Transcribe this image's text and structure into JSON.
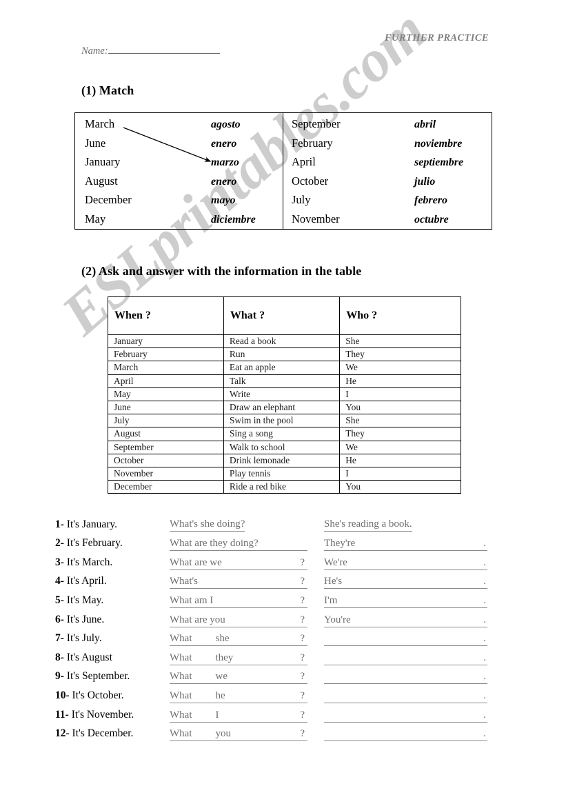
{
  "header": {
    "further_practice": "FURTHER PRACTICE",
    "name_label": "Name:"
  },
  "watermark": {
    "text": "ESLprintables.com",
    "color": "#cdcdcd"
  },
  "section1": {
    "heading": "(1) Match",
    "left_pairs": [
      {
        "english": "March",
        "spanish": "agosto"
      },
      {
        "english": "June",
        "spanish": "enero"
      },
      {
        "english": "January",
        "spanish": "marzo"
      },
      {
        "english": "August",
        "spanish": "enero"
      },
      {
        "english": "December",
        "spanish": "mayo"
      },
      {
        "english": "May",
        "spanish": "diciembre"
      }
    ],
    "right_pairs": [
      {
        "english": "September",
        "spanish": "abril"
      },
      {
        "english": "February",
        "spanish": "noviembre"
      },
      {
        "english": "April",
        "spanish": "septiembre"
      },
      {
        "english": "October",
        "spanish": "julio"
      },
      {
        "english": "July",
        "spanish": "febrero"
      },
      {
        "english": "November",
        "spanish": "octubre"
      }
    ],
    "example_arrow": {
      "from": "March",
      "to": "marzo"
    }
  },
  "section2": {
    "heading": "(2) Ask and answer with the information in the table",
    "columns": [
      "When ?",
      "What ?",
      "Who ?"
    ],
    "rows": [
      [
        "January",
        "Read a book",
        "She"
      ],
      [
        "February",
        "Run",
        "They"
      ],
      [
        "March",
        "Eat an apple",
        "We"
      ],
      [
        "April",
        "Talk",
        "He"
      ],
      [
        "May",
        "Write",
        "I"
      ],
      [
        "June",
        "Draw an elephant",
        "You"
      ],
      [
        "July",
        "Swim in the pool",
        "She"
      ],
      [
        "August",
        "Sing a song",
        "They"
      ],
      [
        "September",
        "Walk to school",
        "We"
      ],
      [
        "October",
        "Drink lemonade",
        "He"
      ],
      [
        "November",
        "Play tennis",
        "I"
      ],
      [
        "December",
        "Ride a red bike",
        "You"
      ]
    ]
  },
  "exercises": [
    {
      "num": "1-",
      "prompt": "It's January.",
      "q_word": "What's",
      "q_pronoun": "she doing?",
      "q_spaced": false,
      "q_mark": "",
      "answer": "She's reading a book.",
      "a_dot": "",
      "tight": true
    },
    {
      "num": "2-",
      "prompt": "It's February.",
      "q_word": "What are",
      "q_pronoun": "they doing?",
      "q_spaced": false,
      "q_mark": "",
      "answer": "They're",
      "a_dot": ".",
      "tight": false
    },
    {
      "num": "3-",
      "prompt": "It's March.",
      "q_word": "What are",
      "q_pronoun": "we",
      "q_spaced": false,
      "q_mark": "?",
      "answer": "We're",
      "a_dot": ".",
      "tight": false
    },
    {
      "num": "4-",
      "prompt": "It's April.",
      "q_word": "What's",
      "q_pronoun": "",
      "q_spaced": false,
      "q_mark": "?",
      "answer": "He's",
      "a_dot": ".",
      "tight": false
    },
    {
      "num": "5-",
      "prompt": "It's May.",
      "q_word": "What am",
      "q_pronoun": "I",
      "q_spaced": false,
      "q_mark": "?",
      "answer": "I'm",
      "a_dot": ".",
      "tight": false
    },
    {
      "num": "6-",
      "prompt": "It's June.",
      "q_word": "What are",
      "q_pronoun": "you",
      "q_spaced": false,
      "q_mark": "?",
      "answer": "You're",
      "a_dot": ".",
      "tight": false
    },
    {
      "num": "7-",
      "prompt": "It's July.",
      "q_word": "What",
      "q_pronoun": "she",
      "q_spaced": true,
      "q_mark": "?",
      "answer": "",
      "a_dot": ".",
      "tight": false
    },
    {
      "num": "8-",
      "prompt": "It's August",
      "q_word": "What",
      "q_pronoun": "they",
      "q_spaced": true,
      "q_mark": "?",
      "answer": "",
      "a_dot": ".",
      "tight": false
    },
    {
      "num": "9-",
      "prompt": "It's September.",
      "q_word": "What",
      "q_pronoun": "we",
      "q_spaced": true,
      "q_mark": "?",
      "answer": "",
      "a_dot": ".",
      "tight": false
    },
    {
      "num": "10-",
      "prompt": "It's October.",
      "q_word": "What",
      "q_pronoun": "he",
      "q_spaced": true,
      "q_mark": "?",
      "answer": "",
      "a_dot": ".",
      "tight": false
    },
    {
      "num": "11-",
      "prompt": "It's November.",
      "q_word": "What",
      "q_pronoun": "I",
      "q_spaced": true,
      "q_mark": "?",
      "answer": "",
      "a_dot": ".",
      "tight": false
    },
    {
      "num": "12-",
      "prompt": "It's December.",
      "q_word": "What",
      "q_pronoun": "you",
      "q_spaced": true,
      "q_mark": "?",
      "answer": "",
      "a_dot": ".",
      "tight": false
    }
  ]
}
